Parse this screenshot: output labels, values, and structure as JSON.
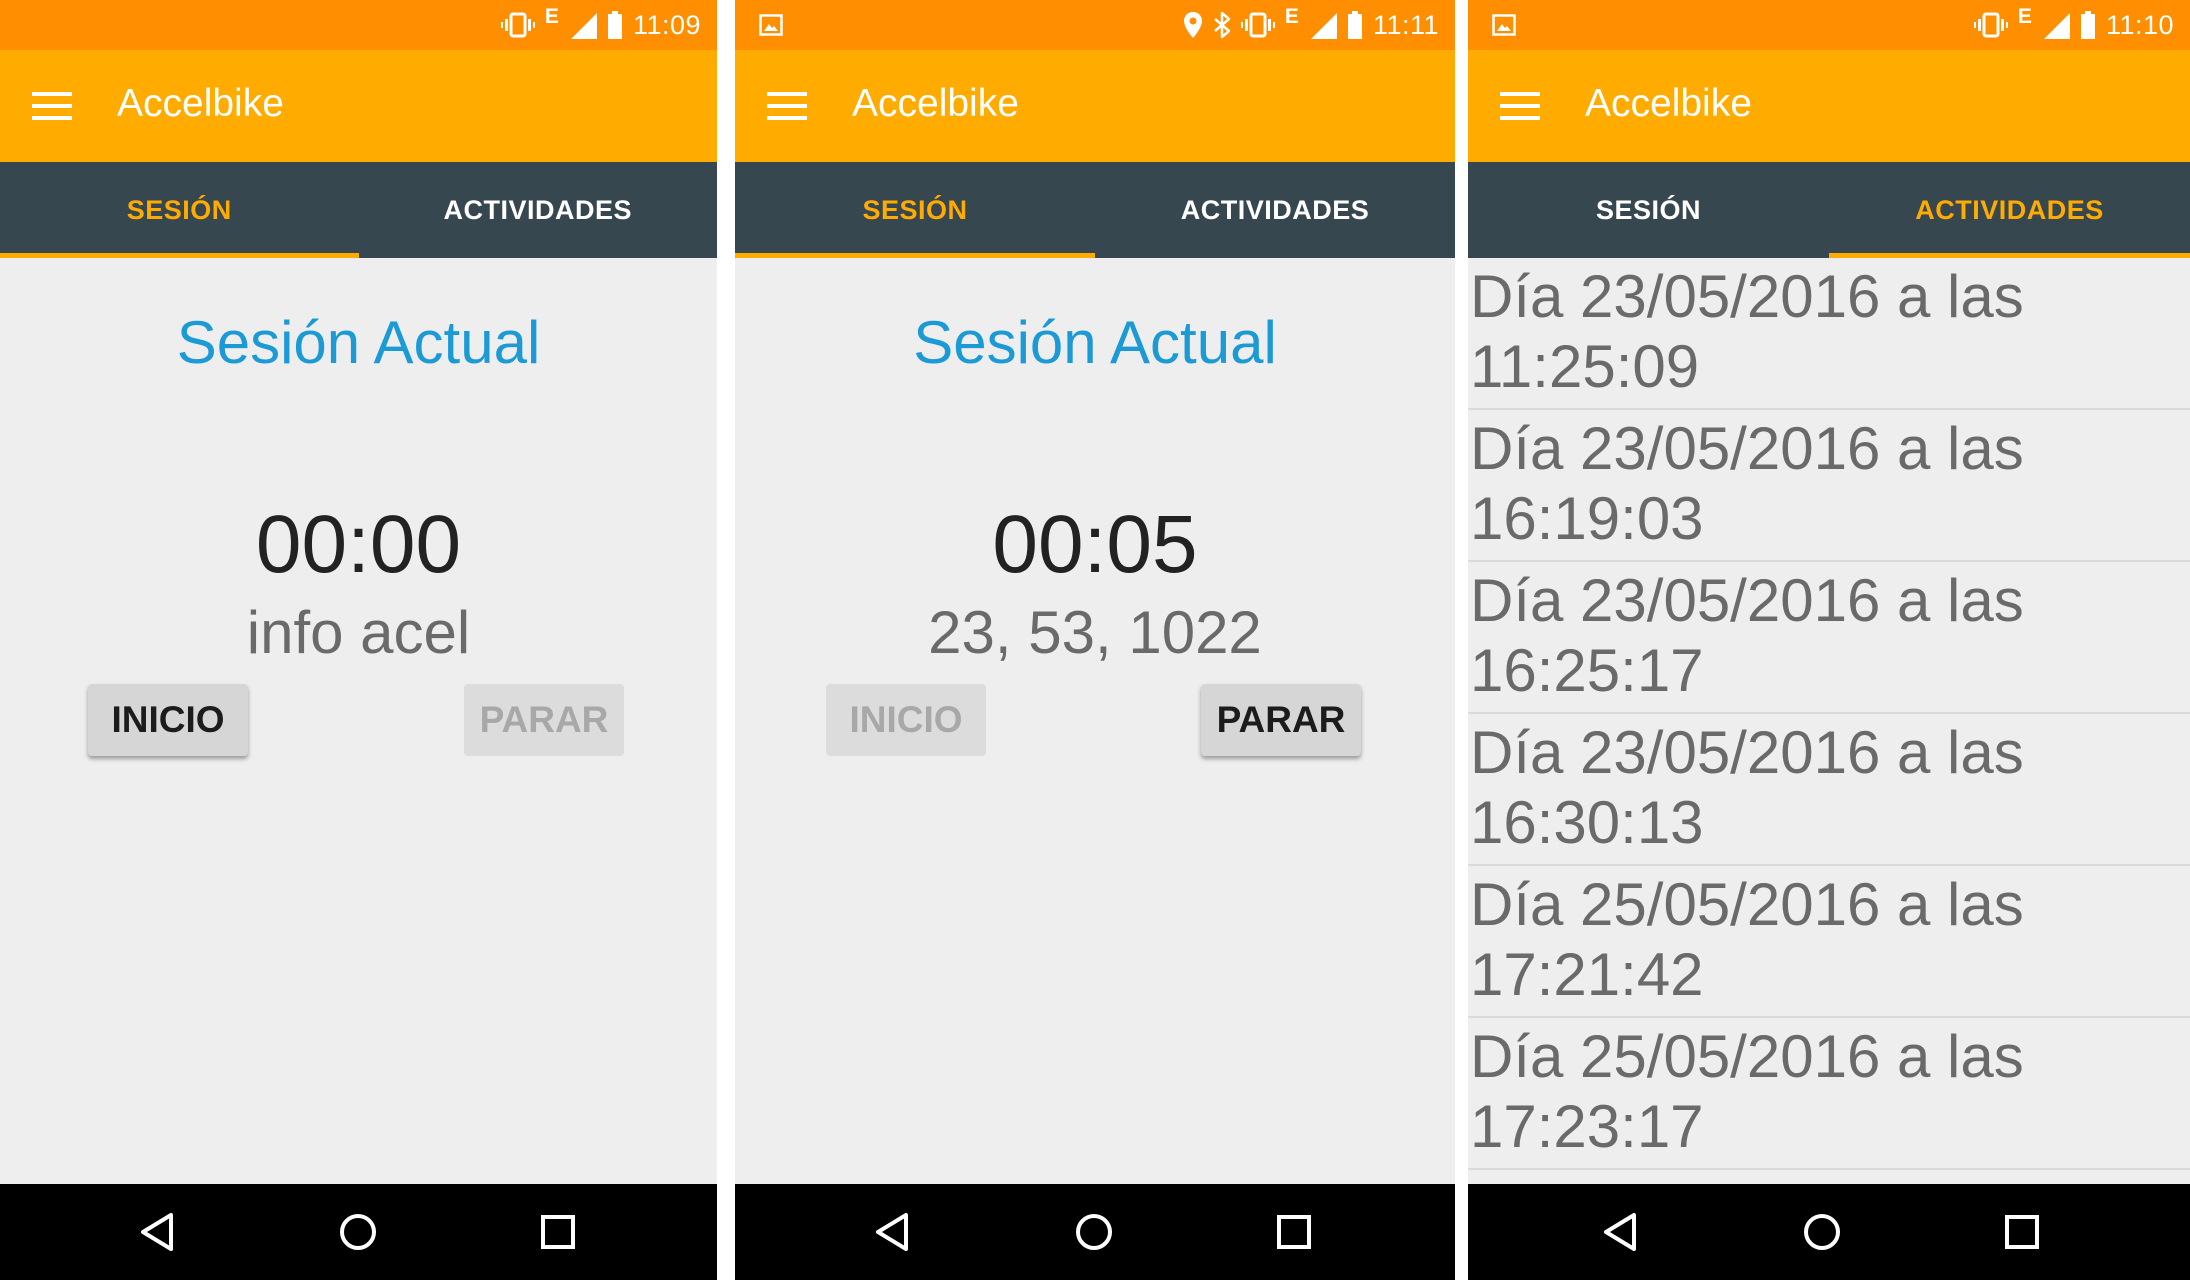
{
  "phones": [
    {
      "status": {
        "time": "11:09",
        "network": "E",
        "icons": [
          "vibrate-icon",
          "signal-icon",
          "battery-icon"
        ]
      },
      "appbar": {
        "title": "Accelbike",
        "menu_icon": "menu-icon"
      },
      "tabs": [
        {
          "label": "SESIÓN",
          "active": true
        },
        {
          "label": "ACTIVIDADES",
          "active": false
        }
      ],
      "session": {
        "title": "Sesión Actual",
        "timer": "00:00",
        "info": "info acel",
        "start_label": "INICIO",
        "stop_label": "PARAR",
        "start_enabled": true,
        "stop_enabled": false
      },
      "navbar": [
        "back-icon",
        "home-icon",
        "recents-icon"
      ]
    },
    {
      "status": {
        "time": "11:11",
        "network": "E",
        "icons": [
          "image-icon",
          "location-icon",
          "bluetooth-icon",
          "vibrate-icon",
          "signal-icon",
          "battery-icon"
        ]
      },
      "appbar": {
        "title": "Accelbike",
        "menu_icon": "menu-icon"
      },
      "tabs": [
        {
          "label": "SESIÓN",
          "active": true
        },
        {
          "label": "ACTIVIDADES",
          "active": false
        }
      ],
      "session": {
        "title": "Sesión Actual",
        "timer": "00:05",
        "info": "23, 53, 1022",
        "start_label": "INICIO",
        "stop_label": "PARAR",
        "start_enabled": false,
        "stop_enabled": true
      },
      "navbar": [
        "back-icon",
        "home-icon",
        "recents-icon"
      ]
    },
    {
      "status": {
        "time": "11:10",
        "network": "E",
        "icons": [
          "image-icon",
          "vibrate-icon",
          "signal-icon",
          "battery-icon"
        ]
      },
      "appbar": {
        "title": "Accelbike",
        "menu_icon": "menu-icon"
      },
      "tabs": [
        {
          "label": "SESIÓN",
          "active": false
        },
        {
          "label": "ACTIVIDADES",
          "active": true
        }
      ],
      "activities": [
        {
          "date_line": "Día 23/05/2016 a las",
          "time_line": "11:25:09"
        },
        {
          "date_line": "Día 23/05/2016 a las",
          "time_line": "16:19:03"
        },
        {
          "date_line": "Día 23/05/2016 a las",
          "time_line": "16:25:17"
        },
        {
          "date_line": "Día 23/05/2016 a las",
          "time_line": "16:30:13"
        },
        {
          "date_line": "Día 25/05/2016 a las",
          "time_line": "17:21:42"
        },
        {
          "date_line": "Día 25/05/2016 a las",
          "time_line": "17:23:17"
        }
      ],
      "navbar": [
        "back-icon",
        "home-icon",
        "recents-icon"
      ]
    }
  ],
  "colors": {
    "status_bar": "#ff8f00",
    "app_bar": "#ffab00",
    "tab_bar": "#37474f",
    "tab_active": "#ffab00",
    "title_blue": "#1b9ad6",
    "background": "#eeeeee"
  }
}
